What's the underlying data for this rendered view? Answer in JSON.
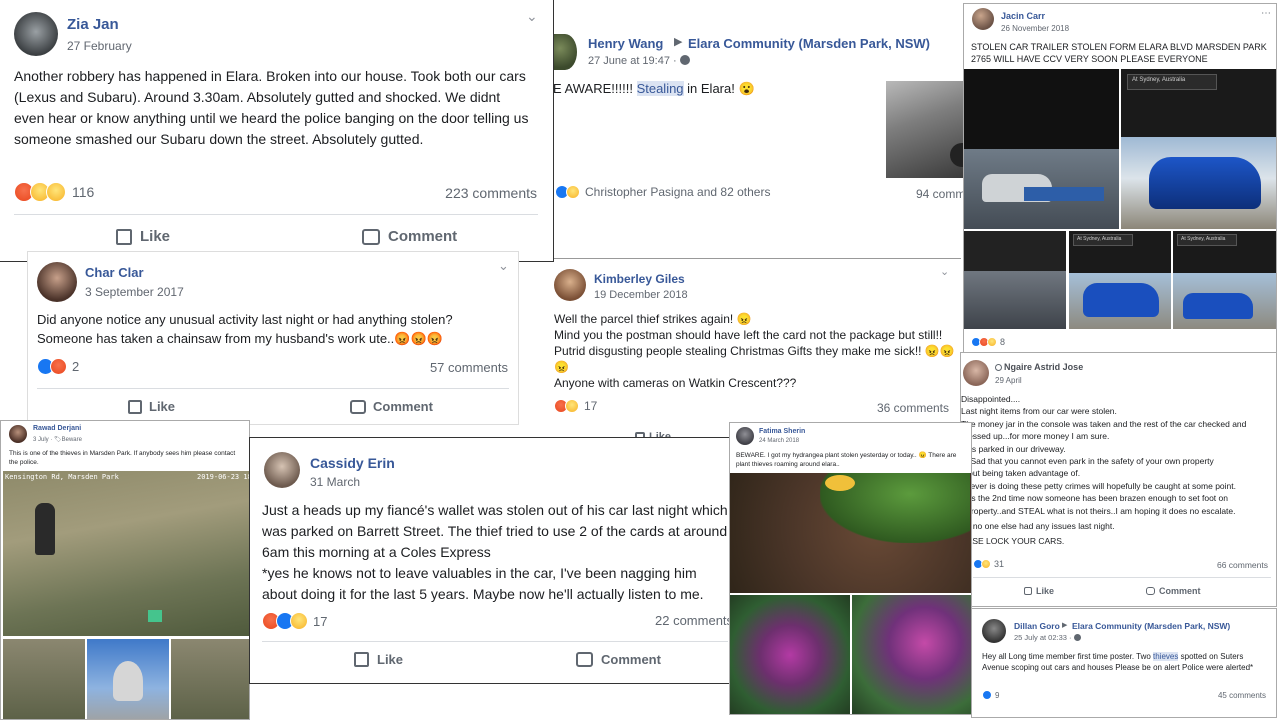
{
  "zia": {
    "name": "Zia Jan",
    "date": "27 February",
    "text": "Another robbery has happened in Elara. Broken into our house. Took both our cars (Lexus and Subaru). Around 3.30am. Absolutely gutted and shocked. We didnt even hear or know anything until we heard the police banging on the door telling us someone smashed our Subaru down the street. Absolutely gutted.",
    "reactions": "116",
    "comments": "223 comments",
    "like": "Like",
    "comment": "Comment"
  },
  "henry": {
    "name": "Henry Wang",
    "group": "Elara Community (Marsden Park, NSW)",
    "date": "27 June at 19:47 · ",
    "text_pre": "E AWARE!!!!!! ",
    "text_hl": "Stealing",
    "text_post": " in Elara! 😮",
    "reactors": "Christopher Pasigna and 82 others",
    "comments": "94 comm"
  },
  "jacin": {
    "name": "Jacin Carr",
    "date": "26 November 2018",
    "text": "STOLEN CAR TRAILER STOLEN FORM ELARA BLVD MARSDEN PARK 2765 WILL HAVE CCV VERY SOON PLEASE EVERYONE",
    "location_label": "At Sydney, Australia",
    "reactions": "8"
  },
  "char": {
    "name": "Char Clar",
    "date": "3 September 2017",
    "text": "Did anyone notice any unusual activity last night or had anything stolen? Someone has taken a chainsaw from my husband's work ute..😡😡😡",
    "reactions": "2",
    "comments": "57 comments",
    "like": "Like",
    "comment": "Comment"
  },
  "kimberley": {
    "name": "Kimberley Giles",
    "date": "19 December 2018",
    "lines": [
      "Well the parcel thief strikes again! 😠",
      "Mind you the postman should have left the card not the package but still!!",
      "Putrid disgusting people stealing Christmas Gifts they make me sick!! 😠😠",
      "😠",
      "Anyone with cameras on Watkin Crescent???"
    ],
    "reactions": "17",
    "comments": "36 comments",
    "like": "Like"
  },
  "ngaire": {
    "name": "Ngaire Astrid Jose",
    "date": "29 April",
    "lines": [
      "Disappointed....",
      "Last night items from our car were stolen.",
      "The money jar in the console was taken and the rest of the car checked and",
      "messed up...for more money I am sure.",
      "was parked in our driveway.",
      "ry Sad that you cannot even park in the safety of your own property",
      "thout being taken advantage of.",
      "hoever is doing these petty crimes will hopefully be caught at some point.",
      "is is the 2nd time now someone has been brazen enough to set foot on",
      "r property..and STEAL what is not theirs..I am hoping it does no escalate.",
      "pe no one else had any issues last night.",
      "EASE LOCK YOUR CARS."
    ],
    "reactions": "31",
    "comments": "66 comments",
    "like": "Like",
    "comment": "Comment"
  },
  "rawad": {
    "name": "Rawad Derjani",
    "meta": "3 July · 🏷Beware",
    "text": "This is one of the thieves in Marsden Park. If anybody sees him please contact the police.",
    "cam_label": "Kensington Rd, Marsden Park",
    "cam_time": "2019-06-23 18"
  },
  "cassidy": {
    "name": "Cassidy Erin",
    "date": "31 March",
    "para1": "Just a heads up my fiancé's wallet was stolen out of his car last night which was parked on Barrett Street. The thief tried to use 2 of the cards at around 6am this morning at a Coles Express",
    "para2": "*yes he knows not to leave valuables in the car, I've been nagging him about doing it for the last 5 years. Maybe now he'll actually listen to me.",
    "reactions": "17",
    "comments": "22 comments",
    "like": "Like",
    "comment": "Comment"
  },
  "fatima": {
    "name": "Fatima Sherin",
    "date": "24 March 2018",
    "text": "BEWARE. I got my hydrangea plant stolen yesterday or today.. 😠 There are plant thieves roaming around elara.."
  },
  "dillan": {
    "name": "Dillan Goro",
    "group": "Elara Community (Marsden Park, NSW)",
    "date": "25 July at 02:33 · ",
    "text_pre": "Hey all Long time member first time poster. Two ",
    "text_hl": "thieves",
    "text_post": " spotted on Suters Avenue scoping out cars and houses Please be on alert Police were alerted*",
    "reactions": "9",
    "comments": "45 comments"
  },
  "icons": [
    "like-icon",
    "comment-icon",
    "chevron-down-icon",
    "globe-icon",
    "play-icon",
    "more-icon"
  ],
  "colors": {
    "name": "#385898",
    "muted": "#606770",
    "like": "#1877f2",
    "angry": "#e9461d",
    "sad": "#f7b125"
  }
}
